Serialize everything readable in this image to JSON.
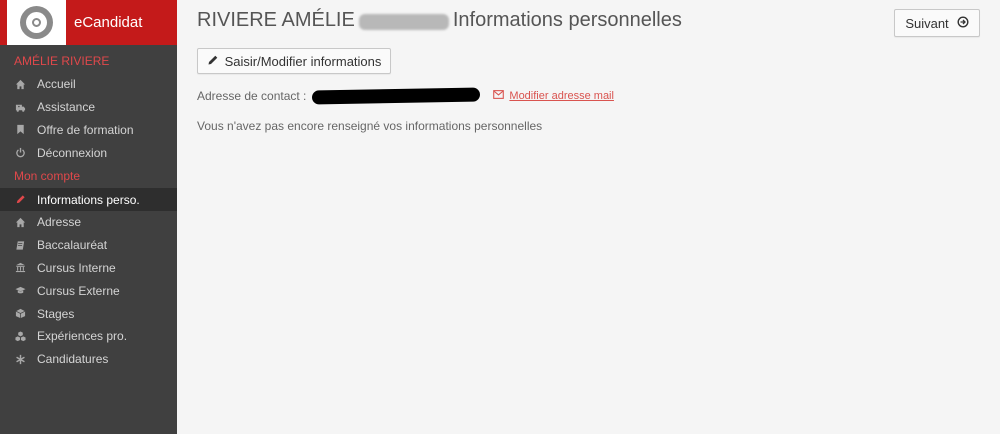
{
  "app": {
    "brand_name": "eCandidat"
  },
  "sidebar": {
    "user_name": "AMÉLIE RIVIERE",
    "main_items": [
      {
        "label": "Accueil",
        "icon": "home-icon"
      },
      {
        "label": "Assistance",
        "icon": "ambulance-icon"
      },
      {
        "label": "Offre de formation",
        "icon": "bookmark-icon"
      },
      {
        "label": "Déconnexion",
        "icon": "power-icon"
      }
    ],
    "account_section_title": "Mon compte",
    "account_items": [
      {
        "label": "Informations perso.",
        "icon": "pencil-icon",
        "active": true
      },
      {
        "label": "Adresse",
        "icon": "home-icon"
      },
      {
        "label": "Baccalauréat",
        "icon": "book-icon"
      },
      {
        "label": "Cursus Interne",
        "icon": "institution-icon"
      },
      {
        "label": "Cursus Externe",
        "icon": "graduation-cap-icon"
      },
      {
        "label": "Stages",
        "icon": "cube-icon"
      },
      {
        "label": "Expériences pro.",
        "icon": "cubes-icon"
      },
      {
        "label": "Candidatures",
        "icon": "asterisk-icon"
      }
    ]
  },
  "header": {
    "name_prefix": "RIVIERE AMÉLIE",
    "page_title": "Informations personnelles",
    "next_button_label": "Suivant"
  },
  "main": {
    "edit_button_label": "Saisir/Modifier informations",
    "contact_label": "Adresse de contact :",
    "modify_mail_link": "Modifier adresse mail",
    "empty_info_message": "Vous n'avez pas encore renseigné vos informations personnelles"
  },
  "colors": {
    "brand_red": "#c41a1a",
    "sidebar_bg": "#404040",
    "section_title": "#e0484b",
    "link_red": "#d9534f"
  }
}
